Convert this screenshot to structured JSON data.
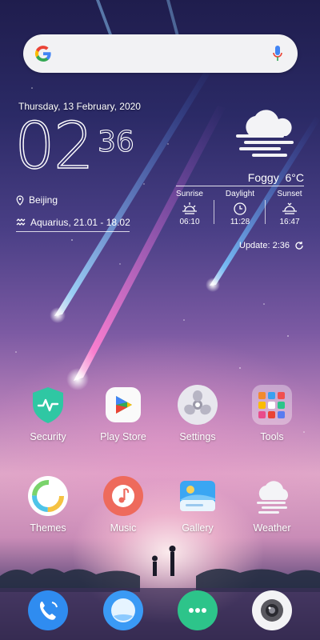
{
  "search": {
    "mic_icon": "microphone-icon",
    "logo": "google-g-icon"
  },
  "clock": {
    "date": "Thursday, 13 February, 2020",
    "hours": "02",
    "minutes": "36",
    "location": "Beijing",
    "zodiac": "Aquarius, 21.01 - 18.02"
  },
  "weather": {
    "condition": "Foggy",
    "temperature": "6°C",
    "columns": [
      {
        "label": "Sunrise",
        "value": "06:10",
        "icon": "sunrise-icon"
      },
      {
        "label": "Daylight",
        "value": "11:28",
        "icon": "clock-icon"
      },
      {
        "label": "Sunset",
        "value": "16:47",
        "icon": "sunset-icon"
      }
    ],
    "update": "Update: 2:36"
  },
  "apps": {
    "row1": [
      {
        "label": "Security",
        "icon": "security-icon",
        "color": "#2bbf9e"
      },
      {
        "label": "Play Store",
        "icon": "play-store-icon",
        "color": "#ffffff"
      },
      {
        "label": "Settings",
        "icon": "settings-icon",
        "color": "#e9e9ee"
      },
      {
        "label": "Tools",
        "icon": "tools-folder-icon",
        "color": "#ffffff"
      }
    ],
    "row2": [
      {
        "label": "Themes",
        "icon": "themes-icon",
        "color": "#ffffff"
      },
      {
        "label": "Music",
        "icon": "music-icon",
        "color": "#f06b5b"
      },
      {
        "label": "Gallery",
        "icon": "gallery-icon",
        "color": "#3aa0f0"
      },
      {
        "label": "Weather",
        "icon": "weather-icon",
        "color": "#ffffff"
      }
    ]
  },
  "dock": [
    {
      "icon": "phone-icon",
      "color": "#2f8cf0"
    },
    {
      "icon": "browser-icon",
      "color": "#3a9af5"
    },
    {
      "icon": "messages-icon",
      "color": "#2dc48a"
    },
    {
      "icon": "camera-icon",
      "color": "#f3f3f5"
    }
  ]
}
